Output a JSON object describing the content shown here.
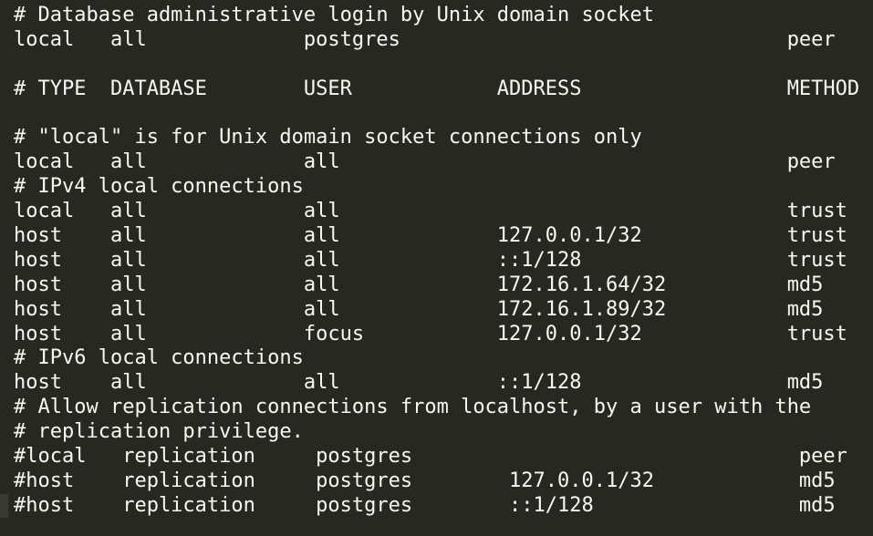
{
  "colors": {
    "background": "#272822",
    "text": "#f8f8f2",
    "gutter_marker": "#3b3a32"
  },
  "lines": [
    {
      "comment": "# Database administrative login by Unix domain socket"
    },
    {
      "type": "local",
      "database": "all",
      "user": "postgres",
      "address": "",
      "method": "peer"
    },
    {
      "blank": true
    },
    {
      "type": "# TYPE",
      "database": "DATABASE",
      "user": "USER",
      "address": "ADDRESS",
      "method": "METHOD"
    },
    {
      "blank": true
    },
    {
      "comment": "# \"local\" is for Unix domain socket connections only"
    },
    {
      "type": "local",
      "database": "all",
      "user": "all",
      "address": "",
      "method": "peer"
    },
    {
      "comment": "# IPv4 local connections"
    },
    {
      "type": "local",
      "database": "all",
      "user": "all",
      "address": "",
      "method": "trust"
    },
    {
      "type": "host",
      "database": "all",
      "user": "all",
      "address": "127.0.0.1/32",
      "method": "trust"
    },
    {
      "type": "host",
      "database": "all",
      "user": "all",
      "address": "::1/128",
      "method": "trust"
    },
    {
      "type": "host",
      "database": "all",
      "user": "all",
      "address": "172.16.1.64/32",
      "method": "md5"
    },
    {
      "type": "host",
      "database": "all",
      "user": "all",
      "address": "172.16.1.89/32",
      "method": "md5"
    },
    {
      "type": "host",
      "database": "all",
      "user": "focus",
      "address": "127.0.0.1/32",
      "method": "trust"
    },
    {
      "comment": "# IPv6 local connections"
    },
    {
      "type": "host",
      "database": "all",
      "user": "all",
      "address": "::1/128",
      "method": "md5"
    },
    {
      "comment": "# Allow replication connections from localhost, by a user with the"
    },
    {
      "comment": "# replication privilege."
    },
    {
      "type": "#local",
      "database": "replication",
      "user": "postgres",
      "address": "",
      "method": "peer",
      "shift": true
    },
    {
      "type": "#host",
      "database": "replication",
      "user": "postgres",
      "address": "127.0.0.1/32",
      "method": "md5",
      "shift": true
    },
    {
      "type": "#host",
      "database": "replication",
      "user": "postgres",
      "address": "::1/128",
      "method": "md5",
      "shift": true,
      "marker": true
    }
  ]
}
